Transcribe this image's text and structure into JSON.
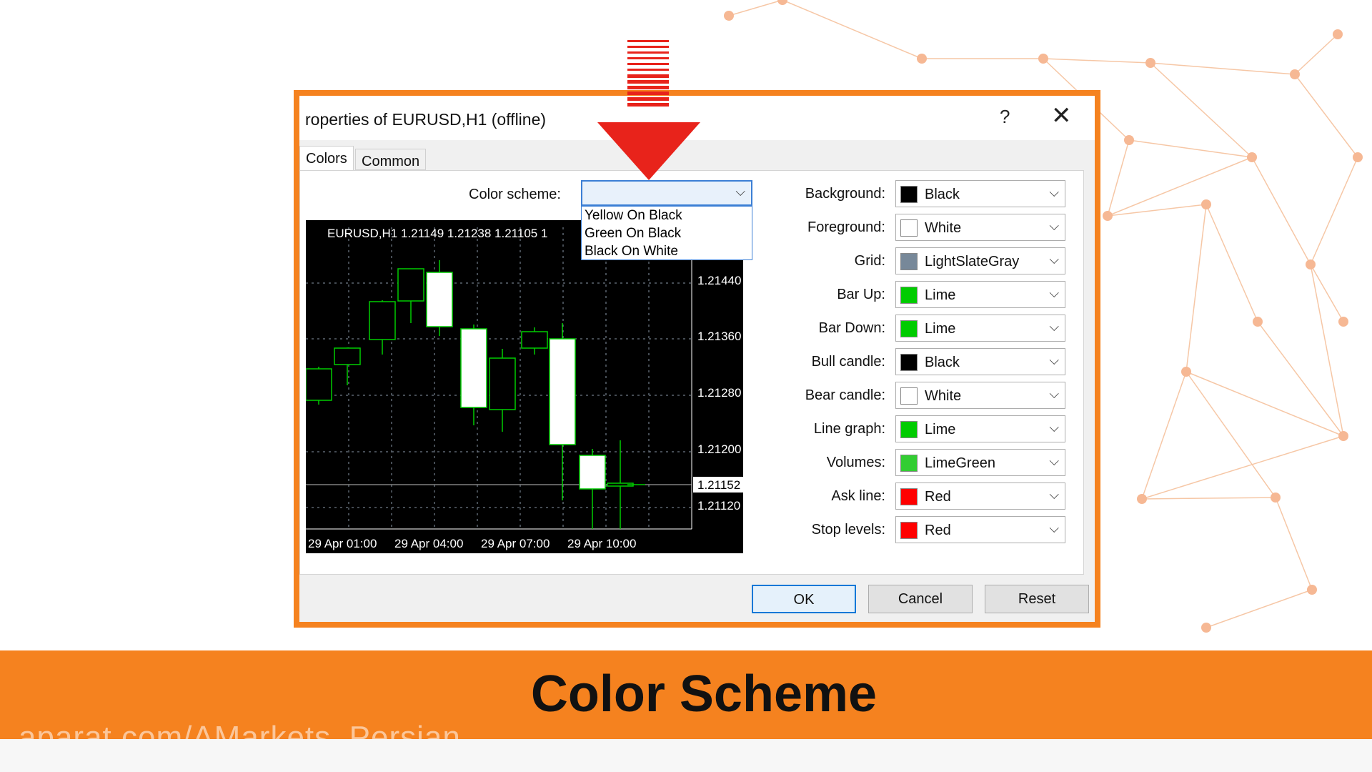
{
  "dialog": {
    "title": "roperties of EURUSD,H1 (offline)",
    "help": "?",
    "close": "✕",
    "tabs": [
      {
        "label": "Colors"
      },
      {
        "label": "Common"
      }
    ]
  },
  "color_scheme": {
    "label": "Color scheme:",
    "selected": "",
    "options": [
      "Yellow On Black",
      "Green On Black",
      "Black On White"
    ]
  },
  "chart": {
    "header": "EURUSD,H1  1.21149 1.21238 1.21105 1",
    "price_labels": [
      "1.21440",
      "1.21360",
      "1.21280",
      "1.21200",
      "1.21152",
      "1.21120"
    ],
    "time_labels": [
      "29 Apr 01:00",
      "29 Apr 04:00",
      "29 Apr 07:00",
      "29 Apr 10:00"
    ]
  },
  "properties": [
    {
      "label": "Background:",
      "value": "Black",
      "color": "#000000"
    },
    {
      "label": "Foreground:",
      "value": "White",
      "color": "#ffffff"
    },
    {
      "label": "Grid:",
      "value": "LightSlateGray",
      "color": "#778899"
    },
    {
      "label": "Bar Up:",
      "value": "Lime",
      "color": "#00cc00"
    },
    {
      "label": "Bar Down:",
      "value": "Lime",
      "color": "#00cc00"
    },
    {
      "label": "Bull candle:",
      "value": "Black",
      "color": "#000000"
    },
    {
      "label": "Bear candle:",
      "value": "White",
      "color": "#ffffff"
    },
    {
      "label": "Line graph:",
      "value": "Lime",
      "color": "#00cc00"
    },
    {
      "label": "Volumes:",
      "value": "LimeGreen",
      "color": "#32cd32"
    },
    {
      "label": "Ask line:",
      "value": "Red",
      "color": "#ff0000"
    },
    {
      "label": "Stop levels:",
      "value": "Red",
      "color": "#ff0000"
    }
  ],
  "buttons": {
    "ok": "OK",
    "cancel": "Cancel",
    "reset": "Reset"
  },
  "banner": {
    "title": "Color Scheme",
    "watermark": "aparat.com/AMarkets_Persian"
  },
  "colors": {
    "accent": "#f5821f",
    "arrow": "#e8231b",
    "focus": "#0078d7"
  }
}
